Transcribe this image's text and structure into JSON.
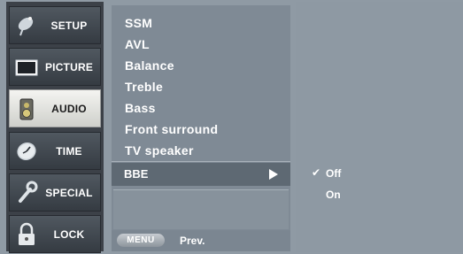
{
  "sidebar": {
    "items": [
      {
        "label": "SETUP",
        "icon": "satellite-dish-icon",
        "active": false
      },
      {
        "label": "PICTURE",
        "icon": "tv-screen-icon",
        "active": false
      },
      {
        "label": "AUDIO",
        "icon": "speaker-icon",
        "active": true
      },
      {
        "label": "TIME",
        "icon": "clock-icon",
        "active": false
      },
      {
        "label": "SPECIAL",
        "icon": "wrench-icon",
        "active": false
      },
      {
        "label": "LOCK",
        "icon": "padlock-icon",
        "active": false
      }
    ]
  },
  "submenu": {
    "items": [
      "SSM",
      "AVL",
      "Balance",
      "Treble",
      "Bass",
      "Front surround",
      "TV speaker"
    ],
    "selected": {
      "label": "BBE",
      "arrow_icon": "right-arrow-icon"
    }
  },
  "footer": {
    "key_label": "MENU",
    "text": "Prev."
  },
  "options": {
    "items": [
      {
        "label": "Off",
        "checked": true
      },
      {
        "label": "On",
        "checked": false
      }
    ],
    "check_glyph": "✔"
  },
  "colors": {
    "background": "#8f9aa4",
    "sidebar": "#3c4148",
    "active_item": "#e6e6e3",
    "submenu": "#7f8a95",
    "selected_row": "#5e6973"
  }
}
